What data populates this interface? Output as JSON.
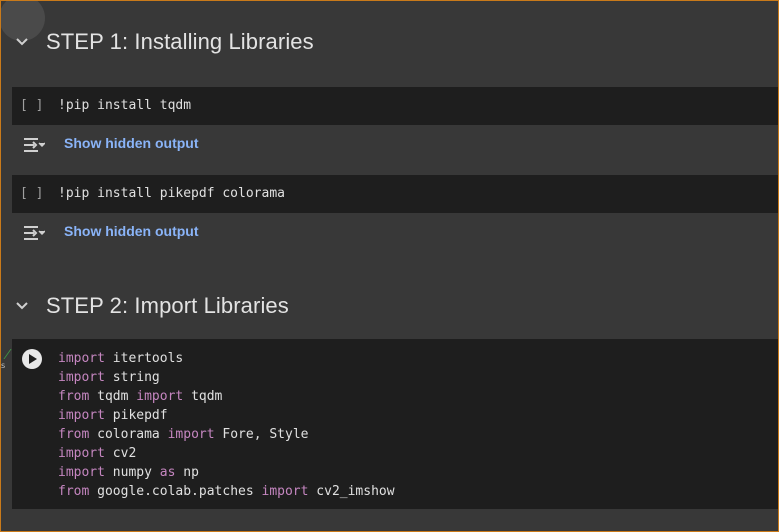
{
  "sections": [
    {
      "title": "STEP 1: Installing Libraries",
      "cells": [
        {
          "run_marker": "[ ]",
          "code": "!pip install tqdm",
          "output_link": "Show hidden output"
        },
        {
          "run_marker": "[ ]",
          "code": "!pip install pikepdf colorama",
          "output_link": "Show hidden output"
        }
      ]
    },
    {
      "title": "STEP 2: Import Libraries",
      "code_lines": [
        {
          "kw1": "import",
          "rest1": " itertools",
          "kw2": "",
          "rest2": ""
        },
        {
          "kw1": "import",
          "rest1": " string",
          "kw2": "",
          "rest2": ""
        },
        {
          "kw1": "from",
          "rest1": " tqdm ",
          "kw2": "import",
          "rest2": " tqdm"
        },
        {
          "kw1": "import",
          "rest1": " pikepdf",
          "kw2": "",
          "rest2": ""
        },
        {
          "kw1": "from",
          "rest1": " colorama ",
          "kw2": "import",
          "rest2": " Fore, Style"
        },
        {
          "kw1": "import",
          "rest1": " cv2",
          "kw2": "",
          "rest2": ""
        },
        {
          "kw1": "import",
          "rest1": " numpy ",
          "kw2": "as",
          "rest2": " np"
        },
        {
          "kw1": "from",
          "rest1": " google.colab.patches ",
          "kw2": "import",
          "rest2": " cv2_imshow"
        }
      ]
    }
  ],
  "side_marker": "s",
  "icons": {
    "chevron": "chevron-down-icon",
    "output": "expand-output-icon",
    "run": "play-icon"
  },
  "colors": {
    "background": "#383838",
    "cell_background": "#1e1e1e",
    "link": "#8ab4f8",
    "keyword": "#c586c0",
    "frame_border": "#c97a1a"
  }
}
